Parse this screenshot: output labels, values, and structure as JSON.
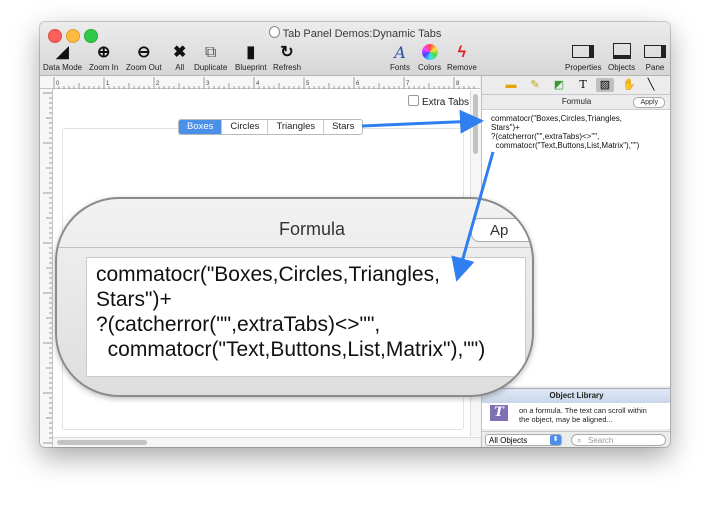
{
  "window": {
    "title": "Tab Panel Demos:Dynamic Tabs"
  },
  "toolbar": {
    "left": [
      {
        "label": "Data Mode",
        "icon": "◢"
      },
      {
        "label": "Zoom In",
        "icon": "⊕"
      },
      {
        "label": "Zoom Out",
        "icon": "⊖"
      },
      {
        "label": "All",
        "icon": "✖"
      },
      {
        "label": "Duplicate",
        "icon": "⧉"
      },
      {
        "label": "Blueprint",
        "icon": "▮"
      },
      {
        "label": "Refresh",
        "icon": "↻"
      }
    ],
    "fonts": {
      "label": "Fonts",
      "icon": "A"
    },
    "colors": {
      "label": "Colors"
    },
    "remove": {
      "label": "Remove",
      "icon": "ϟ"
    },
    "properties": {
      "label": "Properties"
    },
    "objects": {
      "label": "Objects"
    },
    "pane": {
      "label": "Pane"
    }
  },
  "ruler": {
    "marks": [
      "0",
      "1",
      "2",
      "3",
      "4",
      "5",
      "6",
      "7",
      "8"
    ]
  },
  "canvas": {
    "extra_tabs_label": "Extra Tabs",
    "tabs": [
      "Boxes",
      "Circles",
      "Triangles",
      "Stars"
    ],
    "selected_tab": "Boxes"
  },
  "formula_panel": {
    "header": "Formula",
    "apply": "Apply",
    "text": "commatocr(\"Boxes,Circles,Triangles,\nStars\")+\n?(catcherror(\"\",extraTabs)<>\"\",\n  commatocr(\"Text,Buttons,List,Matrix\"),\"\")"
  },
  "object_library": {
    "header": "Object Library",
    "item_text": "on a formula. The text can scroll within the object, may be aligned...",
    "filter": "All Objects",
    "search_placeholder": "Search"
  },
  "callout": {
    "title": "Formula",
    "apply_partial": "Ap",
    "text": "commatocr(\"Boxes,Circles,Triangles,\nStars\")+\n?(catcherror(\"\",extraTabs)<>\"\",\n  commatocr(\"Text,Buttons,List,Matrix\"),\"\")"
  },
  "colors": {
    "accent": "#4a8fe8",
    "arrow": "#2f7ff0"
  }
}
